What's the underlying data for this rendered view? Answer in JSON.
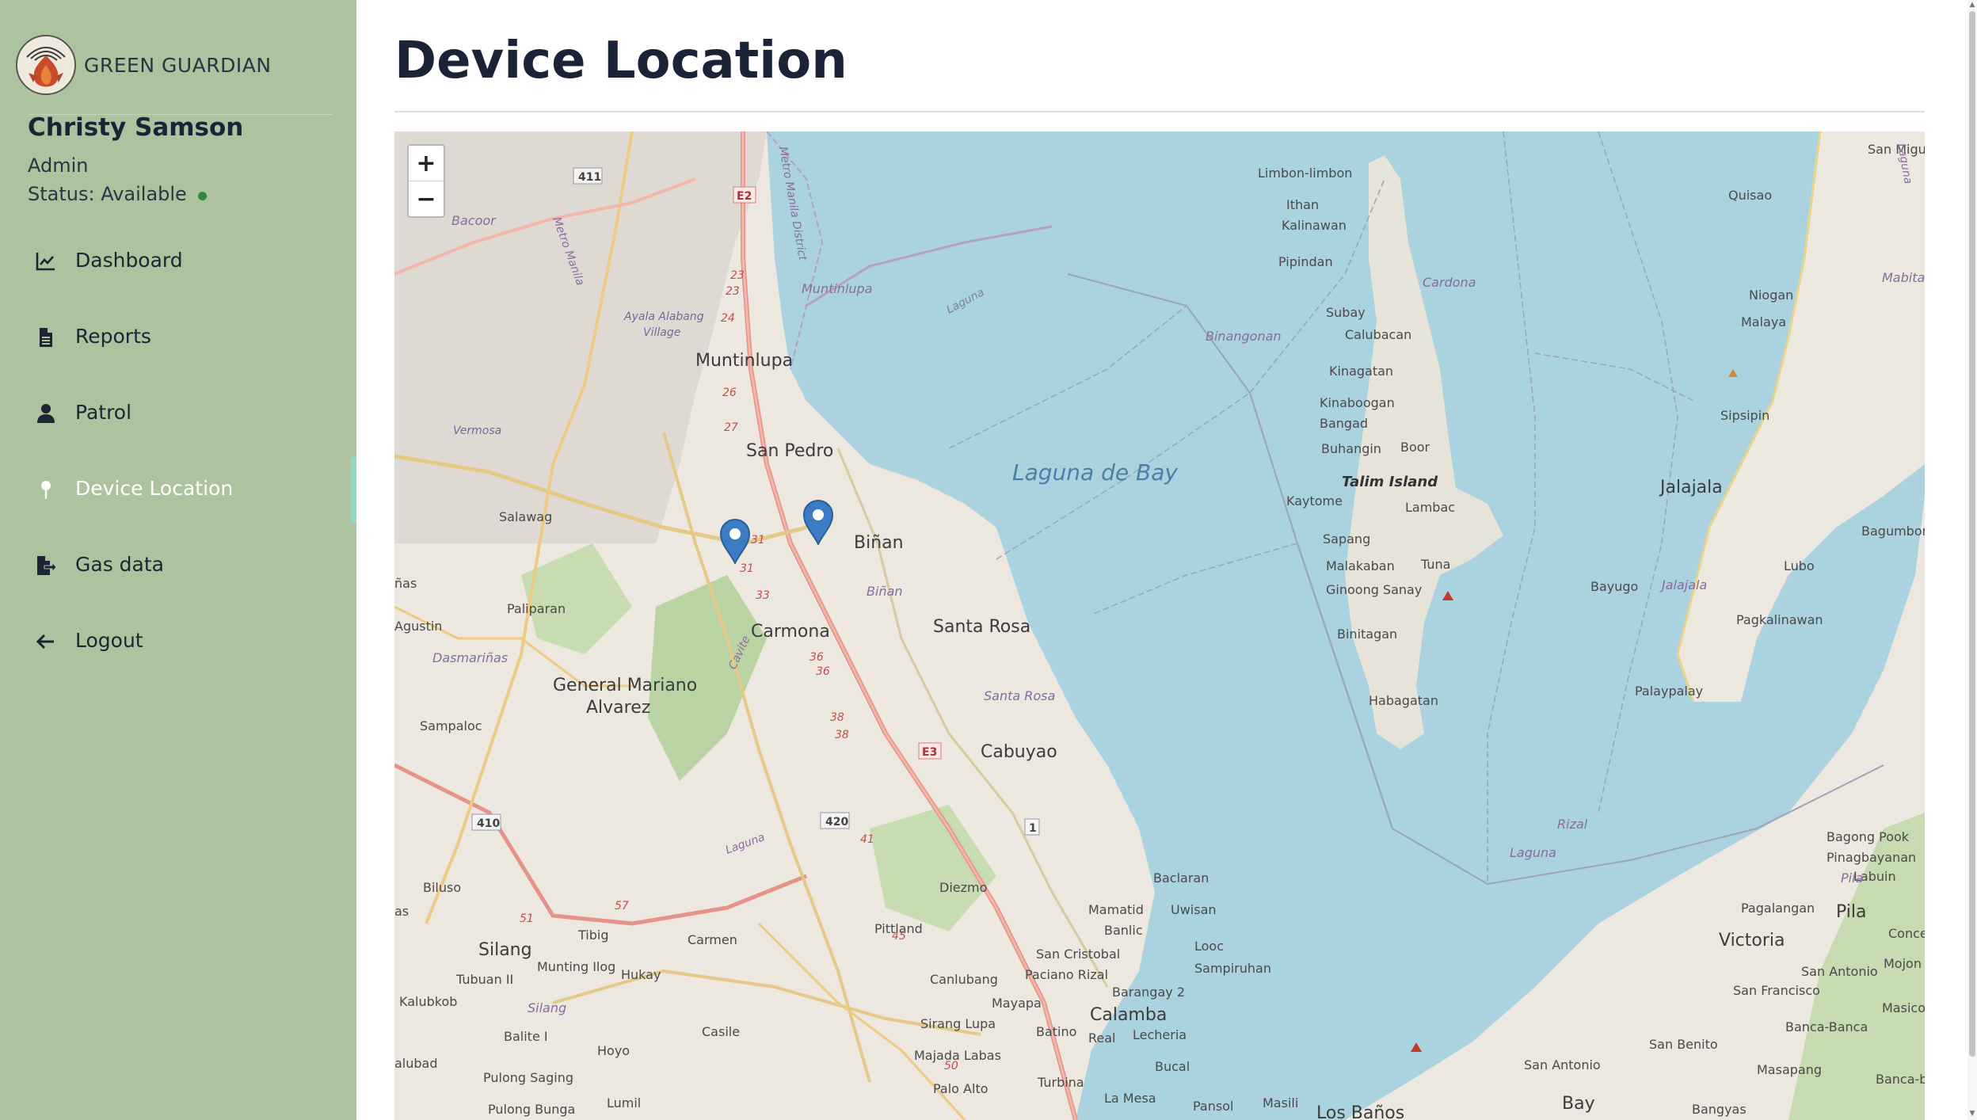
{
  "brand": {
    "name": "GREEN GUARDIAN",
    "logo_icon": "flame-shield-logo"
  },
  "user": {
    "name": "Christy Samson",
    "role": "Admin",
    "status_label": "Status: Available",
    "status_color": "#2c8a3a"
  },
  "nav": {
    "items": [
      {
        "label": "Dashboard",
        "icon": "chart-line-icon"
      },
      {
        "label": "Reports",
        "icon": "file-icon"
      },
      {
        "label": "Patrol",
        "icon": "user-icon"
      },
      {
        "label": "Device Location",
        "icon": "pin-icon",
        "active": true
      },
      {
        "label": "Gas data",
        "icon": "file-export-icon"
      },
      {
        "label": "Logout",
        "icon": "arrow-left-icon"
      }
    ]
  },
  "page": {
    "title": "Device Location"
  },
  "map": {
    "zoom_in_label": "+",
    "zoom_out_label": "−",
    "marker_color": "#3b7cc4",
    "place_labels": {
      "muntinlupa": "Muntinlupa",
      "san_pedro": "San Pedro",
      "binan": "Biñan",
      "carmona": "Carmona",
      "santa_rosa": "Santa Rosa",
      "cabuyao": "Cabuyao",
      "gma": "General Mariano",
      "gma2": "Alvarez",
      "silang": "Silang",
      "calamba": "Calamba",
      "laguna_de_bay": "Laguna de Bay",
      "talim": "Talim Island",
      "jalajala": "Jalajala",
      "victoria": "Victoria",
      "pila": "Pila",
      "bay": "Bay",
      "los_banos": "Los Baños",
      "paliparan": "Paliparan",
      "salawag": "Salawag",
      "sampaloc": "Sampaloc",
      "biluso": "Biluso",
      "kalubkob": "Kalubkob",
      "tubuan": "Tubuan II",
      "bacoor": "Bacoor",
      "vermosa": "Vermosa",
      "dasmarinas": "Dasmariñas",
      "agustin": "Agustin",
      "nas": "ñas",
      "as": "as",
      "alubad": "alubad",
      "tibig": "Tibig",
      "munting_ilog": "Munting Ilog",
      "hukay": "Hukay",
      "carmen": "Carmen",
      "pittland": "Pittland",
      "diezmo": "Diezmo",
      "canlubang": "Canlubang",
      "mayapa": "Mayapa",
      "sirang_lupa": "Sirang Lupa",
      "majada": "Majada Labas",
      "palo_alto": "Palo Alto",
      "casile": "Casile",
      "hoyo": "Hoyo",
      "balite": "Balite I",
      "pulong_saging": "Pulong Saging",
      "pulong_bunga": "Pulong Bunga",
      "lumil": "Lumil",
      "batino": "Batino",
      "real": "Real",
      "turbina": "Turbina",
      "la_mesa": "La Mesa",
      "bucal": "Bucal",
      "lecheria": "Lecheria",
      "pansol": "Pansol",
      "masili": "Masili",
      "san_cristobal": "San Cristobal",
      "paciano": "Paciano Rizal",
      "banlic": "Banlic",
      "mamatid": "Mamatid",
      "baclaran": "Baclaran",
      "uwisan": "Uwisan",
      "looc": "Looc",
      "sampiruhan": "Sampiruhan",
      "barangay2": "Barangay 2",
      "limbon": "Limbon-limbon",
      "ithan": "Ithan",
      "kalinawan": "Kalinawan",
      "pipindan": "Pipindan",
      "subay": "Subay",
      "calubacan": "Calubacan",
      "kinagatan": "Kinagatan",
      "kinaboogan": "Kinaboogan",
      "bangad": "Bangad",
      "buhangin": "Buhangin",
      "boor": "Boor",
      "kaytome": "Kaytome",
      "lambac": "Lambac",
      "sapang": "Sapang",
      "malakaban": "Malakaban",
      "tuna": "Tuna",
      "ginoong_sanay": "Ginoong Sanay",
      "binitagan": "Binitagan",
      "habagatan": "Habagatan",
      "cardona": "Cardona",
      "binangonan": "Binangonan",
      "quisao": "Quisao",
      "san_mig": "San Migu",
      "mabita": "Mabita",
      "niogan": "Niogan",
      "malaya": "Malaya",
      "sipsipin": "Sipsipin",
      "bayugo": "Bayugo",
      "lubo": "Lubo",
      "jalajala_small": "Jalajala",
      "pagkalinawan": "Pagkalinawan",
      "bagumbong": "Bagumbong",
      "palaypalay": "Palaypalay",
      "rizal": "Rizal",
      "laguna_small": "Laguna",
      "bagong_pook": "Bagong Pook",
      "pinagbayanan": "Pinagbayanan",
      "pila_small": "Pila",
      "labuin": "Labuin",
      "pagalangan": "Pagalangan",
      "concep": "Concep",
      "san_antonio": "San Antonio",
      "san_francisco": "San Francisco",
      "mojon": "Mojon",
      "masico": "Masico",
      "banca_banca": "Banca-Banca",
      "san_benito": "San Benito",
      "masapang": "Masapang",
      "banca_ba": "Banca-ba",
      "san_antonio2": "San Antonio",
      "bangyas": "Bangyas",
      "muntinlupa_small": "Muntinlupa",
      "ayala_alabang": "Ayala Alabang",
      "ayala_alabang2": "Village",
      "santa_rosa_small": "Santa Rosa",
      "binan_small": "Biñan",
      "silang_small": "Silang",
      "laguna_road": "Laguna",
      "metro_manila": "Metro Manila",
      "metro_manila_district": "Metro Manila District",
      "cavite": "Cavite",
      "laguna_edge": "Laguna"
    },
    "shields": {
      "s411": "411",
      "e2": "E2",
      "e3": "E3",
      "s410": "410",
      "s420": "420",
      "r1": "1",
      "n23a": "23",
      "n23b": "23",
      "n24": "24",
      "n26": "26",
      "n27": "27",
      "n31a": "31",
      "n31b": "31",
      "n33": "33",
      "n36a": "36",
      "n36b": "36",
      "n38a": "38",
      "n38b": "38",
      "n41": "41",
      "n45": "45",
      "n50": "50",
      "n51": "51",
      "n57": "57"
    }
  }
}
